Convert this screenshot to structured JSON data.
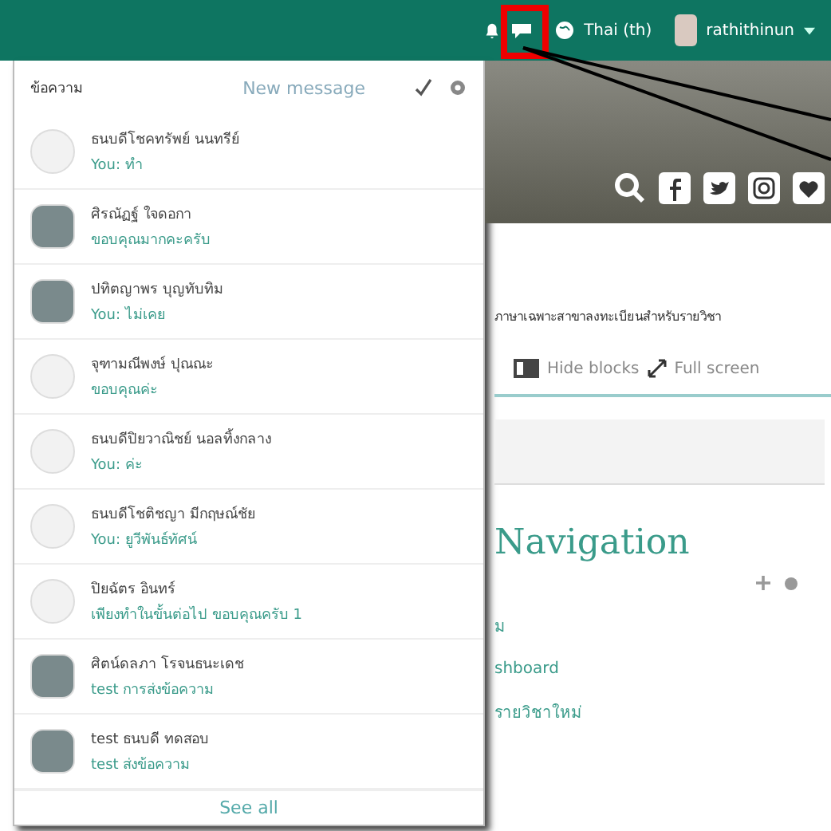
{
  "top_bar": {
    "language": "Thai (th)",
    "user_name": "rathithinun"
  },
  "messages_panel": {
    "title": "ข้อความ",
    "new_message": "New message",
    "conversations": [
      {
        "name": "ธนบดีโชคทรัพย์ นนทรีย์",
        "preview": "You: ทำ",
        "kind": "default"
      },
      {
        "name": "ศิรณัฏฐ์ ใจดอกา",
        "preview": "ขอบคุณมากคะครับ",
        "kind": "photo"
      },
      {
        "name": "ปทิตญาพร บุญทับทิม",
        "preview": "You: ไม่เคย",
        "kind": "photo"
      },
      {
        "name": "จุฑามณีพงษ์ ปุณณะ",
        "preview": "ขอบคุณค่ะ",
        "kind": "default"
      },
      {
        "name": "ธนบดีปิยวาณิชย์ นอลทิ้งกลาง",
        "preview": "You: ค่ะ",
        "kind": "default"
      },
      {
        "name": "ธนบดีโชติชญา มีกฤษณ์ชัย",
        "preview": "You: ยูวีพันธ์ทัศน์",
        "kind": "default"
      },
      {
        "name": "ปิยฉัตร อินทร์",
        "preview": "เพียงทำในขั้นต่อไป ขอบคุณครับ 1",
        "kind": "default"
      },
      {
        "name": "ศิตน์ดลภา โรจนธนะเดช",
        "preview": "test การส่งข้อความ",
        "kind": "photo"
      },
      {
        "name": "test ธนบดี ทดสอบ",
        "preview": "test ส่งข้อความ",
        "kind": "photo"
      }
    ],
    "see_all": "See all"
  },
  "page": {
    "enrol_text": "ภาษาเฉพาะสาขาลงทะเบียนสำหรับรายวิชา",
    "hide_blocks": "Hide blocks",
    "full_screen": "Full screen",
    "block_title": "Navigation",
    "links": [
      "ม",
      "shboard",
      "รายวิชาใหม่"
    ]
  }
}
